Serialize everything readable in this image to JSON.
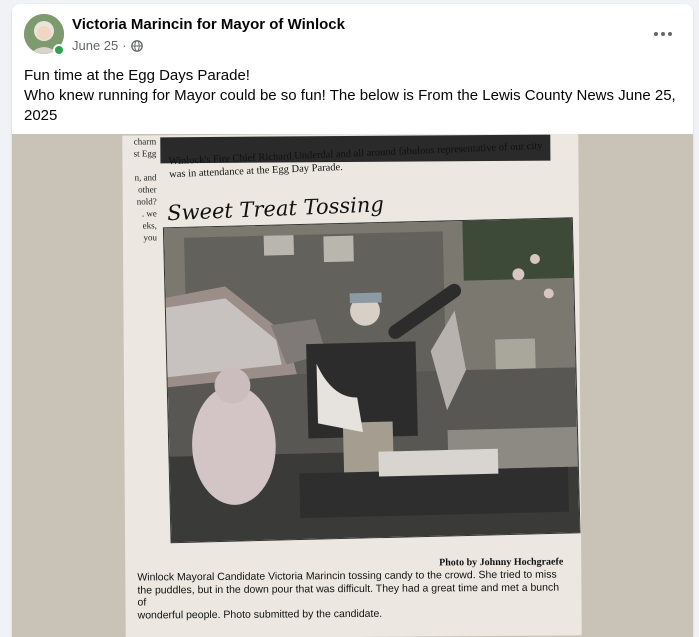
{
  "post": {
    "page_name": "Victoria Marincin for Mayor of Winlock",
    "date": "June 25",
    "separator": "·",
    "audience_icon": "globe-icon",
    "more_icon": "more-options-icon",
    "text_lines": [
      "Fun time at the Egg Days Parade!",
      "Who knew running for Mayor could be so fun! The below is From the Lewis County News June 25, 2025"
    ]
  },
  "clipping": {
    "left_column": [
      "charm",
      "st Egg",
      "",
      "n, and",
      "other",
      "nold?",
      ". we",
      "eks,",
      "you"
    ],
    "lead_text": "Winlock's Fire Chief Richard Underdal and all around fabulous representative of our city was in attendance at the Egg Day Parade.",
    "headline": "Sweet Treat Tossing",
    "photo_credit": "Photo by Johnny Hochgraefe",
    "caption_lines": [
      "Winlock Mayoral Candidate Victoria Marincin tossing candy to the crowd. She tried to miss",
      "the puddles, but in the down pour that was difficult. They had a great time and met a bunch of",
      "wonderful people. Photo submitted by the candidate."
    ]
  },
  "colors": {
    "online": "#31a24c",
    "meta_text": "#65676b",
    "card_bg": "#ffffff",
    "feed_bg": "#f0f2f5"
  }
}
